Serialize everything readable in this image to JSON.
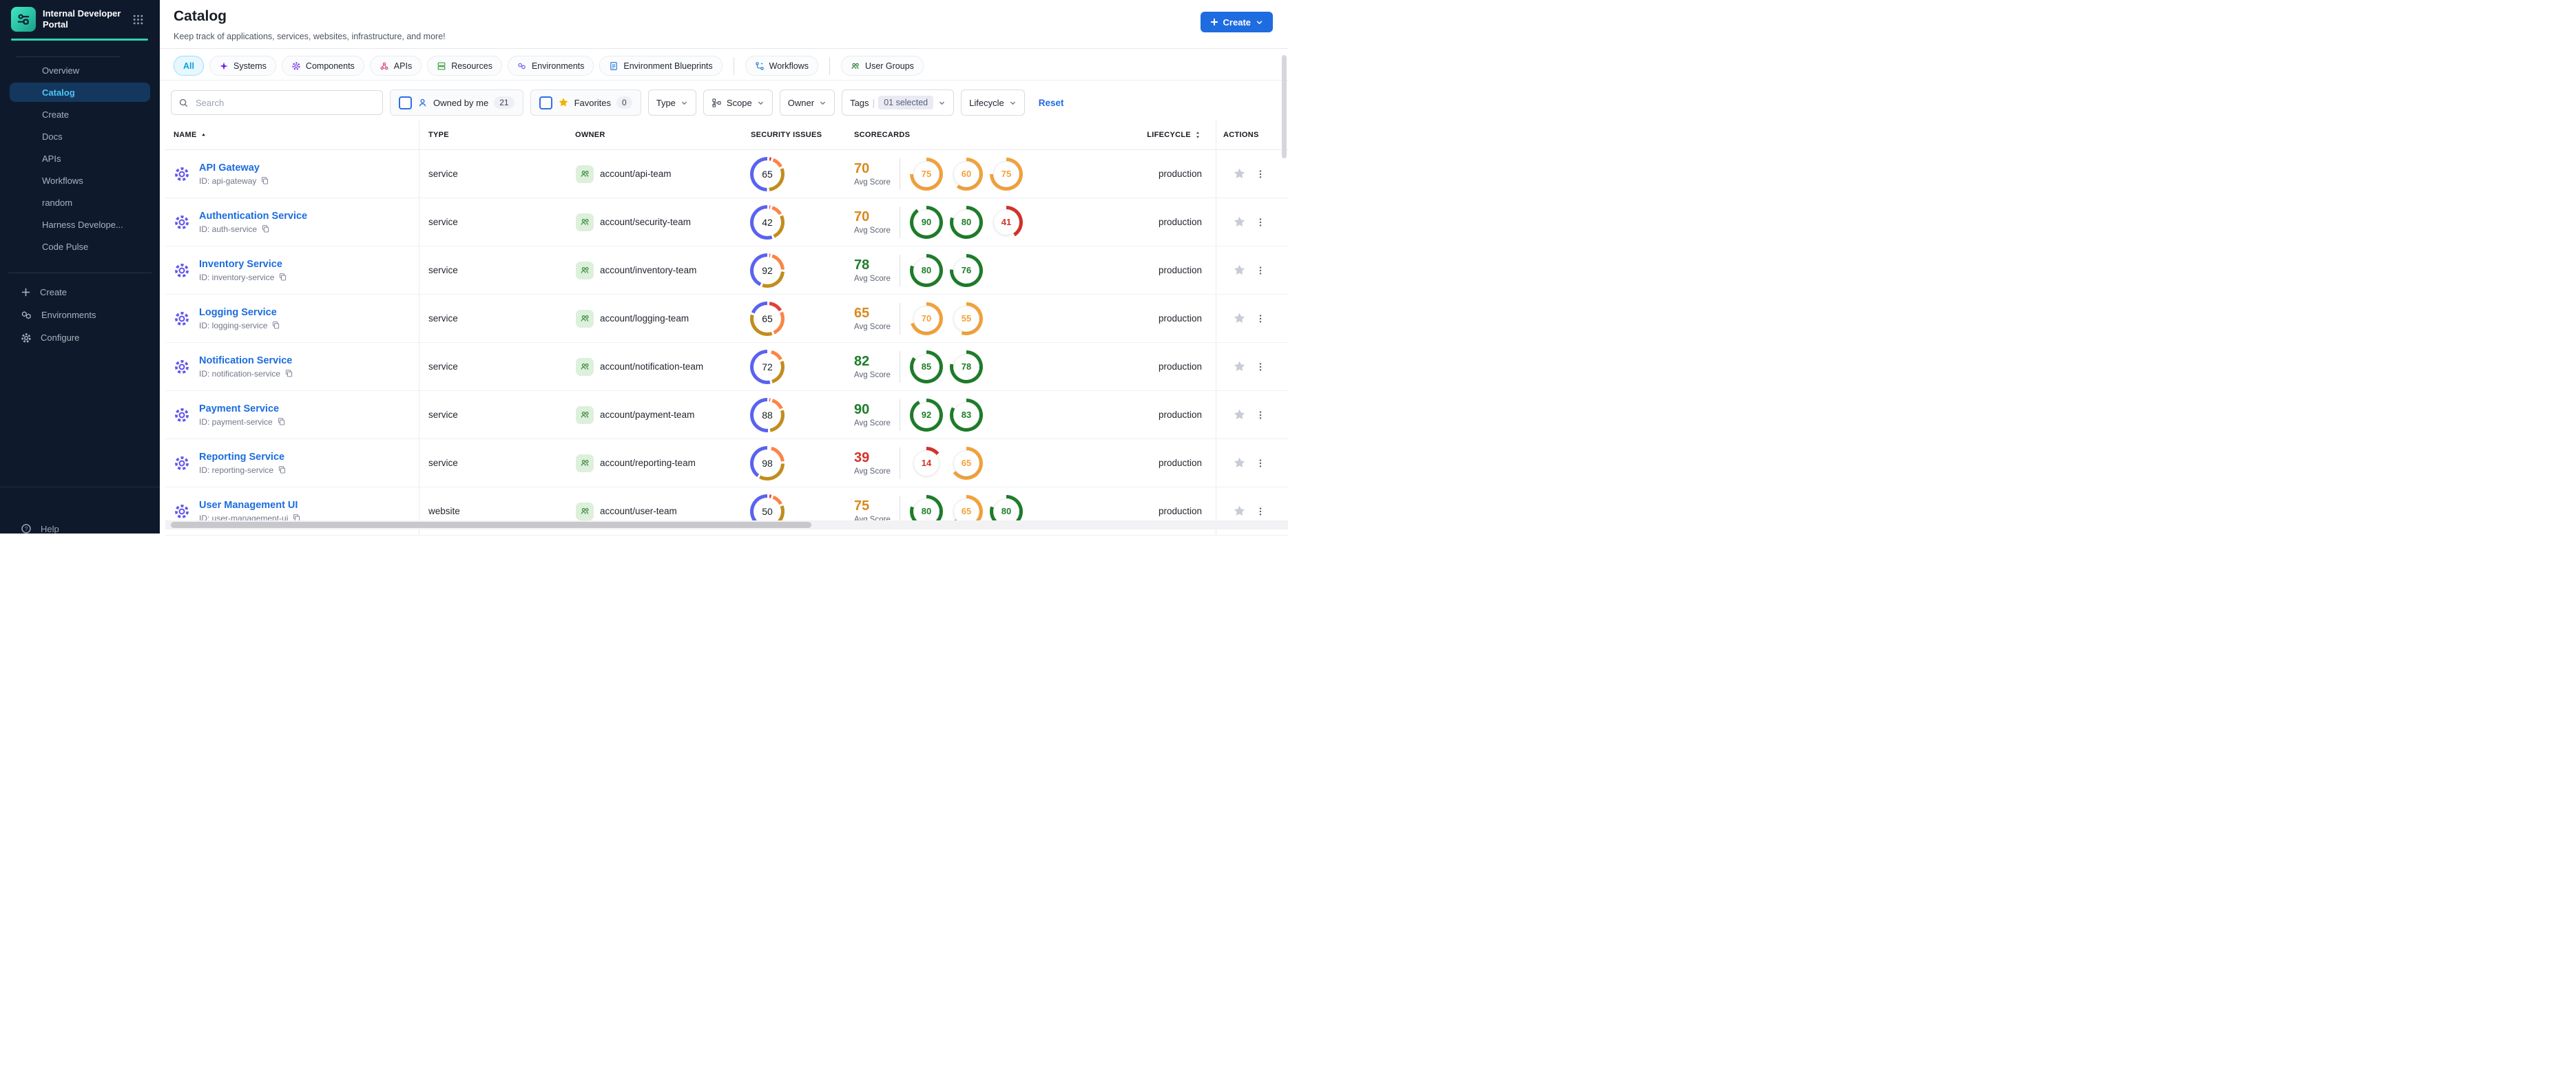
{
  "sidebar": {
    "logo_title": "Internal Developer Portal",
    "menu": [
      {
        "label": "Overview",
        "selected": false
      },
      {
        "label": "Catalog",
        "selected": true
      },
      {
        "label": "Create",
        "selected": false
      },
      {
        "label": "Docs",
        "selected": false
      },
      {
        "label": "APIs",
        "selected": false
      },
      {
        "label": "Workflows",
        "selected": false
      },
      {
        "label": "random",
        "selected": false
      },
      {
        "label": "Harness Develope...",
        "selected": false
      },
      {
        "label": "Code Pulse",
        "selected": false
      }
    ],
    "footer_menu": [
      {
        "icon": "plus-icon",
        "label": "Create"
      },
      {
        "icon": "hexagons-icon",
        "label": "Environments"
      },
      {
        "icon": "gear-icon",
        "label": "Configure"
      }
    ],
    "help_label": "Help"
  },
  "header": {
    "title": "Catalog",
    "subtitle": "Keep track of applications, services, websites, infrastructure, and more!",
    "create_button": "Create"
  },
  "tabs": [
    {
      "label": "All",
      "selected": true
    },
    {
      "label": "Systems",
      "icon": "systems-icon",
      "color": "#6d28d9"
    },
    {
      "label": "Components",
      "icon": "components-icon",
      "color": "#7c3aed"
    },
    {
      "label": "APIs",
      "icon": "apis-icon",
      "color": "#e0447c"
    },
    {
      "label": "Resources",
      "icon": "resources-icon",
      "color": "#3f9e3f"
    },
    {
      "label": "Environments",
      "icon": "environments-icon",
      "color": "#7a5cf0"
    },
    {
      "label": "Environment Blueprints",
      "icon": "blueprints-icon",
      "color": "#2e7fe0"
    },
    {
      "divider": true
    },
    {
      "label": "Workflows",
      "icon": "workflows-icon",
      "color": "#2e7fe0"
    },
    {
      "divider": true
    },
    {
      "label": "User Groups",
      "icon": "usergroups-icon",
      "color": "#2c7d2c"
    }
  ],
  "filters": {
    "search_placeholder": "Search",
    "owned_by_me": {
      "label": "Owned by me",
      "count": "21"
    },
    "favorites": {
      "label": "Favorites",
      "count": "0"
    },
    "type_label": "Type",
    "scope_label": "Scope",
    "owner_label": "Owner",
    "tags_label": "Tags",
    "tags_selected": "01 selected",
    "lifecycle_label": "Lifecycle",
    "reset_label": "Reset"
  },
  "table": {
    "columns": [
      "NAME",
      "TYPE",
      "OWNER",
      "SECURITY ISSUES",
      "SCORECARDS",
      "LIFECYCLE",
      "ACTIONS"
    ],
    "avg_score_label": "Avg Score",
    "rows": [
      {
        "name": "API Gateway",
        "id": "ID: api-gateway",
        "type": "service",
        "owner": "account/api-team",
        "security": {
          "value": "65",
          "segments": [
            {
              "color": "red",
              "pct": 4
            },
            {
              "color": "orange",
              "pct": 13
            },
            {
              "color": "gold",
              "pct": 31
            },
            {
              "color": "blue",
              "pct": 52
            }
          ]
        },
        "scorecards": {
          "avg": "70",
          "avg_color": "amber",
          "rings": [
            {
              "value": "75",
              "color": "amber"
            },
            {
              "value": "60",
              "color": "amber"
            },
            {
              "value": "75",
              "color": "amber"
            }
          ]
        },
        "lifecycle": "production"
      },
      {
        "name": "Authentication Service",
        "id": "ID: auth-service",
        "type": "service",
        "owner": "account/security-team",
        "security": {
          "value": "42",
          "segments": [
            {
              "color": "red",
              "pct": 3
            },
            {
              "color": "orange",
              "pct": 13
            },
            {
              "color": "gold",
              "pct": 27
            },
            {
              "color": "blue",
              "pct": 57
            }
          ]
        },
        "scorecards": {
          "avg": "70",
          "avg_color": "amber",
          "rings": [
            {
              "value": "90",
              "color": "green"
            },
            {
              "value": "80",
              "color": "green"
            },
            {
              "value": "41",
              "color": "red"
            }
          ]
        },
        "lifecycle": "production"
      },
      {
        "name": "Inventory Service",
        "id": "ID: inventory-service",
        "type": "service",
        "owner": "account/inventory-team",
        "security": {
          "value": "92",
          "segments": [
            {
              "color": "red",
              "pct": 3
            },
            {
              "color": "orange",
              "pct": 21
            },
            {
              "color": "gold",
              "pct": 31
            },
            {
              "color": "blue",
              "pct": 45
            }
          ]
        },
        "scorecards": {
          "avg": "78",
          "avg_color": "green",
          "rings": [
            {
              "value": "80",
              "color": "green"
            },
            {
              "value": "76",
              "color": "green"
            }
          ]
        },
        "lifecycle": "production"
      },
      {
        "name": "Logging Service",
        "id": "ID: logging-service",
        "type": "service",
        "owner": "account/logging-team",
        "security": {
          "value": "65",
          "segments": [
            {
              "color": "red",
              "pct": 16
            },
            {
              "color": "orange",
              "pct": 27
            },
            {
              "color": "gold",
              "pct": 36
            },
            {
              "color": "blue",
              "pct": 21
            }
          ]
        },
        "scorecards": {
          "avg": "65",
          "avg_color": "amber",
          "rings": [
            {
              "value": "70",
              "color": "amber"
            },
            {
              "value": "55",
              "color": "amber"
            }
          ]
        },
        "lifecycle": "production"
      },
      {
        "name": "Notification Service",
        "id": "ID: notification-service",
        "type": "service",
        "owner": "account/notification-team",
        "security": {
          "value": "72",
          "segments": [
            {
              "color": "red",
              "pct": 2
            },
            {
              "color": "orange",
              "pct": 15
            },
            {
              "color": "gold",
              "pct": 28
            },
            {
              "color": "blue",
              "pct": 55
            }
          ]
        },
        "scorecards": {
          "avg": "82",
          "avg_color": "green",
          "rings": [
            {
              "value": "85",
              "color": "green"
            },
            {
              "value": "78",
              "color": "green"
            }
          ]
        },
        "lifecycle": "production"
      },
      {
        "name": "Payment Service",
        "id": "ID: payment-service",
        "type": "service",
        "owner": "account/payment-team",
        "security": {
          "value": "88",
          "segments": [
            {
              "color": "red",
              "pct": 3
            },
            {
              "color": "orange",
              "pct": 15
            },
            {
              "color": "gold",
              "pct": 29
            },
            {
              "color": "blue",
              "pct": 53
            }
          ]
        },
        "scorecards": {
          "avg": "90",
          "avg_color": "green",
          "rings": [
            {
              "value": "92",
              "color": "green"
            },
            {
              "value": "83",
              "color": "green"
            }
          ]
        },
        "lifecycle": "production"
      },
      {
        "name": "Reporting Service",
        "id": "ID: reporting-service",
        "type": "service",
        "owner": "account/reporting-team",
        "security": {
          "value": "98",
          "segments": [
            {
              "color": "red",
              "pct": 2
            },
            {
              "color": "orange",
              "pct": 21
            },
            {
              "color": "gold",
              "pct": 35
            },
            {
              "color": "blue",
              "pct": 42
            }
          ]
        },
        "scorecards": {
          "avg": "39",
          "avg_color": "red",
          "rings": [
            {
              "value": "14",
              "color": "red"
            },
            {
              "value": "65",
              "color": "amber"
            }
          ]
        },
        "lifecycle": "production"
      },
      {
        "name": "User Management UI",
        "id": "ID: user-management-ui",
        "type": "website",
        "owner": "account/user-team",
        "security": {
          "value": "50",
          "segments": [
            {
              "color": "red",
              "pct": 4
            },
            {
              "color": "orange",
              "pct": 13
            },
            {
              "color": "gold",
              "pct": 31
            },
            {
              "color": "blue",
              "pct": 52
            }
          ]
        },
        "scorecards": {
          "avg": "75",
          "avg_color": "amber",
          "rings": [
            {
              "value": "80",
              "color": "green"
            },
            {
              "value": "65",
              "color": "amber"
            },
            {
              "value": "80",
              "color": "green"
            }
          ]
        },
        "lifecycle": "production"
      }
    ]
  },
  "colors": {
    "accent_blue": "#1f6be0",
    "donut_blue": "#5a62f0",
    "donut_gold": "#c28d1e",
    "donut_orange": "#fb8546",
    "donut_red": "#e04038",
    "ring_green": "#1e7d29",
    "ring_amber": "#f2a23a",
    "ring_red": "#d3312a",
    "avg_amber": "#d8891c",
    "avg_green": "#1e7d29",
    "avg_red": "#d3312a",
    "sidebar_bg": "#0e1a2b",
    "teal": "#2fd0b5"
  }
}
